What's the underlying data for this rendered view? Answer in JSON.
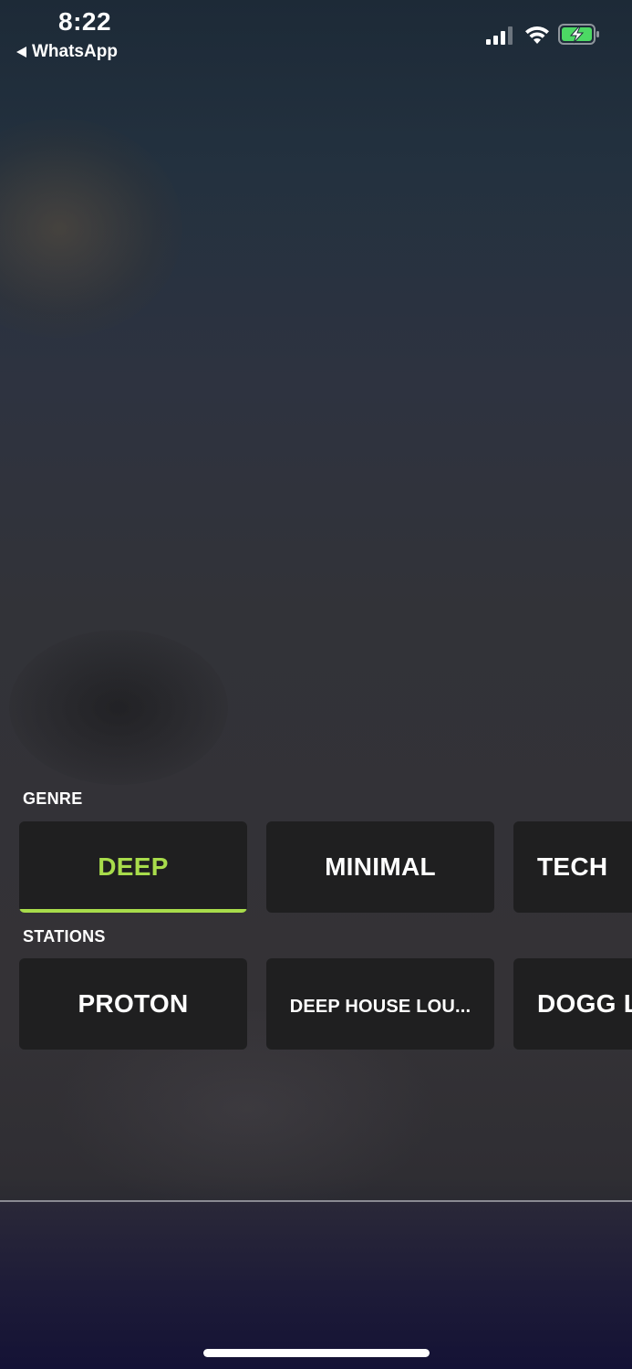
{
  "status_bar": {
    "time": "8:22",
    "back_label": "WhatsApp",
    "signal_icon": "cellular-signal-icon",
    "wifi_icon": "wifi-icon",
    "battery_icon": "battery-charging-icon",
    "battery_color": "#4cd964"
  },
  "genre": {
    "label": "GENRE",
    "items": [
      {
        "label": "DEEP",
        "selected": true
      },
      {
        "label": "MINIMAL",
        "selected": false
      },
      {
        "label": "TECH",
        "selected": false
      }
    ]
  },
  "stations": {
    "label": "STATIONS",
    "items": [
      {
        "label": "PROTON"
      },
      {
        "label": "DEEP HOUSE LOU..."
      },
      {
        "label": "DOGG LO"
      }
    ]
  },
  "colors": {
    "accent": "#a8dc4b",
    "tile_bg": "#1f1f20"
  }
}
